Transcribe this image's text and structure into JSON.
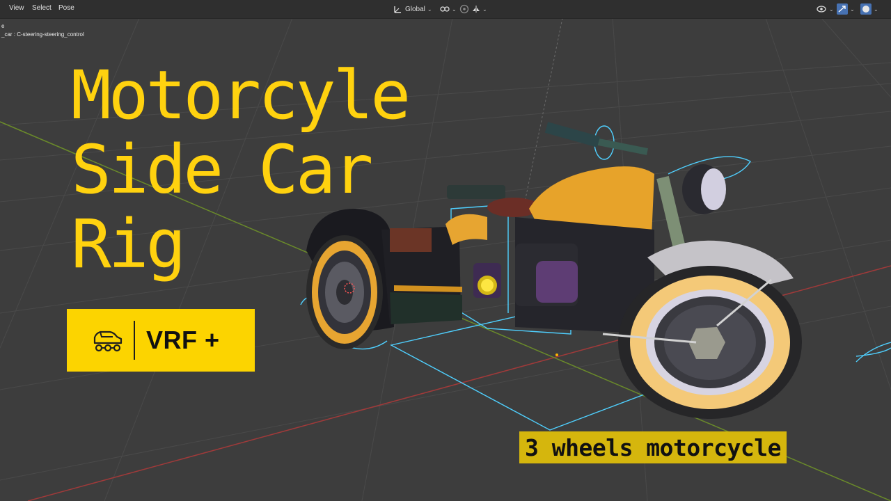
{
  "header": {
    "menu": [
      "View",
      "Select",
      "Pose"
    ],
    "transform_orientation": "Global"
  },
  "overlay": {
    "mode_line": "e",
    "active_bone": "_car : C-steering-steering_control"
  },
  "title": {
    "lines": [
      "Motorcyle",
      "Side Car",
      "Rig"
    ],
    "color": "#ffd20f"
  },
  "badge": {
    "text": "VRF +",
    "background": "#fcd400"
  },
  "caption": {
    "text": "3 wheels motorcycle",
    "background": "#d5b60d"
  },
  "icons": [
    "transform-pivot-icon",
    "snap-icon",
    "proportional-edit-icon",
    "mirror-icon",
    "overlay-icon",
    "gizmo-icon",
    "shading-icon",
    "car-icon"
  ]
}
